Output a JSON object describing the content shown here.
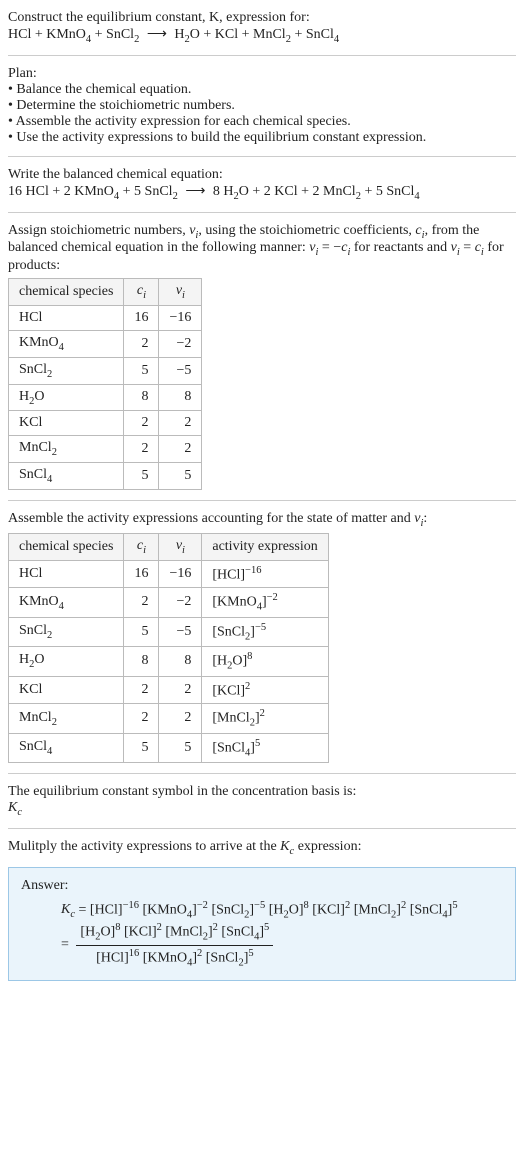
{
  "intro": {
    "line1": "Construct the equilibrium constant, K, expression for:",
    "equation_html": "HCl + KMnO<sub>4</sub> + SnCl<sub>2</sub> <span class='arrow'>⟶</span> H<sub>2</sub>O + KCl + MnCl<sub>2</sub> + SnCl<sub>4</sub>"
  },
  "plan": {
    "heading": "Plan:",
    "items": [
      "• Balance the chemical equation.",
      "• Determine the stoichiometric numbers.",
      "• Assemble the activity expression for each chemical species.",
      "• Use the activity expressions to build the equilibrium constant expression."
    ]
  },
  "balanced": {
    "heading": "Write the balanced chemical equation:",
    "equation_html": "16 HCl + 2 KMnO<sub>4</sub> + 5 SnCl<sub>2</sub> <span class='arrow'>⟶</span> 8 H<sub>2</sub>O + 2 KCl + 2 MnCl<sub>2</sub> + 5 SnCl<sub>4</sub>"
  },
  "stoich": {
    "heading_html": "Assign stoichiometric numbers, <i>ν<sub>i</sub></i>, using the stoichiometric coefficients, <i>c<sub>i</sub></i>, from the balanced chemical equation in the following manner: <i>ν<sub>i</sub></i> = −<i>c<sub>i</sub></i> for reactants and <i>ν<sub>i</sub></i> = <i>c<sub>i</sub></i> for products:",
    "headers": {
      "species": "chemical species",
      "ci_html": "<i>c<sub>i</sub></i>",
      "vi_html": "<i>ν<sub>i</sub></i>"
    },
    "rows": [
      {
        "species_html": "HCl",
        "ci": "16",
        "vi": "−16"
      },
      {
        "species_html": "KMnO<sub>4</sub>",
        "ci": "2",
        "vi": "−2"
      },
      {
        "species_html": "SnCl<sub>2</sub>",
        "ci": "5",
        "vi": "−5"
      },
      {
        "species_html": "H<sub>2</sub>O",
        "ci": "8",
        "vi": "8"
      },
      {
        "species_html": "KCl",
        "ci": "2",
        "vi": "2"
      },
      {
        "species_html": "MnCl<sub>2</sub>",
        "ci": "2",
        "vi": "2"
      },
      {
        "species_html": "SnCl<sub>4</sub>",
        "ci": "5",
        "vi": "5"
      }
    ]
  },
  "activity": {
    "heading_html": "Assemble the activity expressions accounting for the state of matter and <i>ν<sub>i</sub></i>:",
    "headers": {
      "species": "chemical species",
      "ci_html": "<i>c<sub>i</sub></i>",
      "vi_html": "<i>ν<sub>i</sub></i>",
      "act": "activity expression"
    },
    "rows": [
      {
        "species_html": "HCl",
        "ci": "16",
        "vi": "−16",
        "act_html": "[HCl]<sup>−16</sup>"
      },
      {
        "species_html": "KMnO<sub>4</sub>",
        "ci": "2",
        "vi": "−2",
        "act_html": "[KMnO<sub>4</sub>]<sup>−2</sup>"
      },
      {
        "species_html": "SnCl<sub>2</sub>",
        "ci": "5",
        "vi": "−5",
        "act_html": "[SnCl<sub>2</sub>]<sup>−5</sup>"
      },
      {
        "species_html": "H<sub>2</sub>O",
        "ci": "8",
        "vi": "8",
        "act_html": "[H<sub>2</sub>O]<sup>8</sup>"
      },
      {
        "species_html": "KCl",
        "ci": "2",
        "vi": "2",
        "act_html": "[KCl]<sup>2</sup>"
      },
      {
        "species_html": "MnCl<sub>2</sub>",
        "ci": "2",
        "vi": "2",
        "act_html": "[MnCl<sub>2</sub>]<sup>2</sup>"
      },
      {
        "species_html": "SnCl<sub>4</sub>",
        "ci": "5",
        "vi": "5",
        "act_html": "[SnCl<sub>4</sub>]<sup>5</sup>"
      }
    ]
  },
  "eqconst": {
    "line1": "The equilibrium constant symbol in the concentration basis is:",
    "symbol_html": "<i>K<sub>c</sub></i>"
  },
  "multiply": {
    "heading_html": "Mulitply the activity expressions to arrive at the <i>K<sub>c</sub></i> expression:"
  },
  "answer": {
    "label": "Answer:",
    "line1_html": "<i>K<sub>c</sub></i> = [HCl]<sup>−16</sup> [KMnO<sub>4</sub>]<sup>−2</sup> [SnCl<sub>2</sub>]<sup>−5</sup> [H<sub>2</sub>O]<sup>8</sup> [KCl]<sup>2</sup> [MnCl<sub>2</sub>]<sup>2</sup> [SnCl<sub>4</sub>]<sup>5</sup>",
    "eq_prefix": "= ",
    "frac_num_html": "[H<sub>2</sub>O]<sup>8</sup> [KCl]<sup>2</sup> [MnCl<sub>2</sub>]<sup>2</sup> [SnCl<sub>4</sub>]<sup>5</sup>",
    "frac_den_html": "[HCl]<sup>16</sup> [KMnO<sub>4</sub>]<sup>2</sup> [SnCl<sub>2</sub>]<sup>5</sup>"
  }
}
